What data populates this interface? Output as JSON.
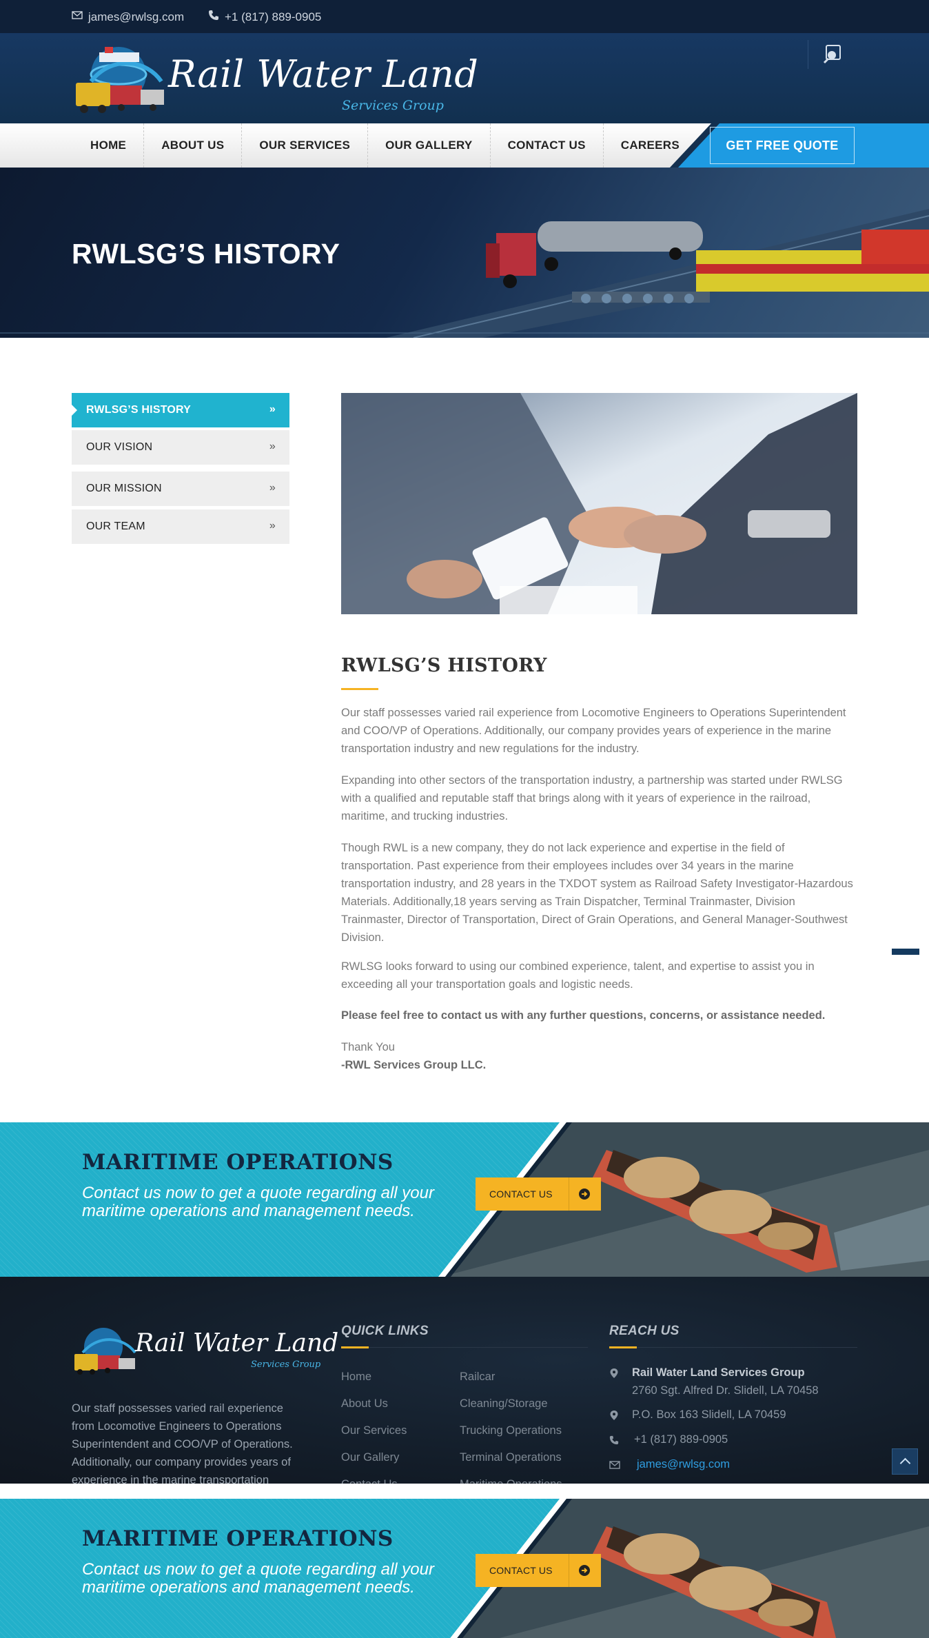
{
  "topbar": {
    "email": "james@rwlsg.com",
    "phone": "+1 (817) 889-0905"
  },
  "header": {
    "logo_title": "Rail Water Land",
    "logo_subtitle": "Services Group"
  },
  "nav": {
    "items": [
      {
        "label": "HOME"
      },
      {
        "label": "ABOUT US"
      },
      {
        "label": "OUR SERVICES"
      },
      {
        "label": "OUR GALLERY"
      },
      {
        "label": "CONTACT US"
      },
      {
        "label": "CAREERS"
      }
    ],
    "quote_label": "GET FREE QUOTE"
  },
  "banner": {
    "title": "RWLSG’S HISTORY"
  },
  "sidebar": {
    "items": [
      {
        "label": "RWLSG’S HISTORY",
        "active": true
      },
      {
        "label": "OUR VISION",
        "active": false
      },
      {
        "label": "OUR MISSION",
        "active": false
      },
      {
        "label": "OUR TEAM",
        "active": false
      }
    ]
  },
  "content": {
    "title": "RWLSG’S HISTORY",
    "paragraphs": [
      "Our staff possesses varied rail experience from Locomotive Engineers to Operations Superintendent and COO/VP of Operations. Additionally, our company provides years of experience in the marine transportation industry and new regulations for the industry.",
      "Expanding into other sectors of the transportation industry, a partnership was started under RWLSG with a qualified and reputable staff that brings along with it years of experience in the railroad, maritime, and trucking industries.",
      "Though RWL is a new company, they do not lack experience and expertise in the field of transportation. Past experience from their employees includes over 34 years in the marine transportation industry, and 28 years in the TXDOT system as Railroad Safety Investigator-Hazardous Materials. Additionally,18 years serving as Train Dispatcher, Terminal Trainmaster, Division Trainmaster, Director of Transportation, Direct of Grain Operations, and General Manager-Southwest Division.",
      "RWLSG looks forward to using our combined experience, talent, and expertise to assist you in exceeding all your transportation goals and logistic needs."
    ],
    "closing_bold": "Please feel free to contact us with any further questions, concerns, or assistance needed.",
    "thank_you": "Thank You",
    "signature": "-RWL Services Group LLC."
  },
  "cta": {
    "title": "MARITIME OPERATIONS",
    "text": "Contact us now to get a quote regarding all your maritime operations and management needs.",
    "button_label": "CONTACT US"
  },
  "footer": {
    "logo_title": "Rail Water Land",
    "logo_subtitle": "Services Group",
    "about": "Our staff possesses varied rail experience from Locomotive Engineers to Operations Superintendent and COO/VP of Operations. Additionally, our company provides years of experience in the marine transportation",
    "quick_links_heading": "QUICK LINKS",
    "quick_links_col1": [
      "Home",
      "About Us",
      "Our Services",
      "Our Gallery",
      "Contact Us"
    ],
    "quick_links_col2": [
      "Railcar",
      "Cleaning/Storage",
      "Trucking Operations",
      "Terminal Operations",
      "Maritime Operations"
    ],
    "reach_heading": "REACH US",
    "company": "Rail Water Land Services Group",
    "address": "2760 Sgt. Alfred Dr. Slidell, LA 70458",
    "po_box": "P.O. Box 163 Slidell, LA 70459",
    "phone": "+1 (817) 889-0905",
    "email": "james@rwlsg.com"
  },
  "colors": {
    "accent_cyan": "#20b3cf",
    "accent_blue": "#1e9be2",
    "accent_yellow": "#f5b323",
    "navy": "#12304f"
  },
  "icons": {
    "topbar_email": "envelope-icon",
    "topbar_phone": "phone-icon",
    "search": "search-icon",
    "sidebar_chevron": "double-chevron-right-icon",
    "cta_arrow": "arrow-circle-right-icon",
    "footer_pin": "map-pin-icon",
    "footer_phone": "phone-icon",
    "footer_email": "envelope-icon",
    "scroll_top": "chevron-up-icon"
  }
}
